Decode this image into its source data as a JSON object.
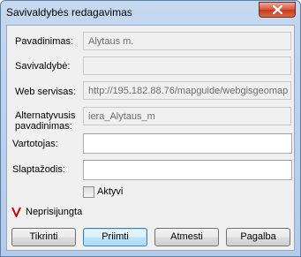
{
  "window": {
    "title": "Savivaldybės redagavimas"
  },
  "form": {
    "fields": [
      {
        "label": "Pavadinimas:",
        "value": "Alytaus m.",
        "editable": false
      },
      {
        "label": "Savivaldybė:",
        "value": "",
        "editable": false
      },
      {
        "label": "Web servisas:",
        "value": "http://195.182.88.76/mapguide/webgisgeomap",
        "editable": false
      },
      {
        "label_line1": "Alternatyvusis",
        "label_line2": "pavadinimas:",
        "value": "iera_Alytaus_m",
        "editable": false
      },
      {
        "label": "Vartotojas:",
        "value": "",
        "editable": true
      },
      {
        "label": "Slaptažodis:",
        "value": "",
        "editable": true
      }
    ],
    "active_checkbox": {
      "label": "Aktyvi",
      "checked": false
    }
  },
  "status": {
    "text": "Neprisijungta",
    "icon": "red-v-icon",
    "icon_color": "#cc0000"
  },
  "buttons": {
    "test": "Tikrinti",
    "accept": "Priimti",
    "cancel": "Atmesti",
    "help": "Pagalba"
  },
  "colors": {
    "title_bar": "#b9cfe9",
    "close_button": "#c94a2c",
    "dialog_bg": "#f0f0f0",
    "default_button": "#bee6fd"
  }
}
